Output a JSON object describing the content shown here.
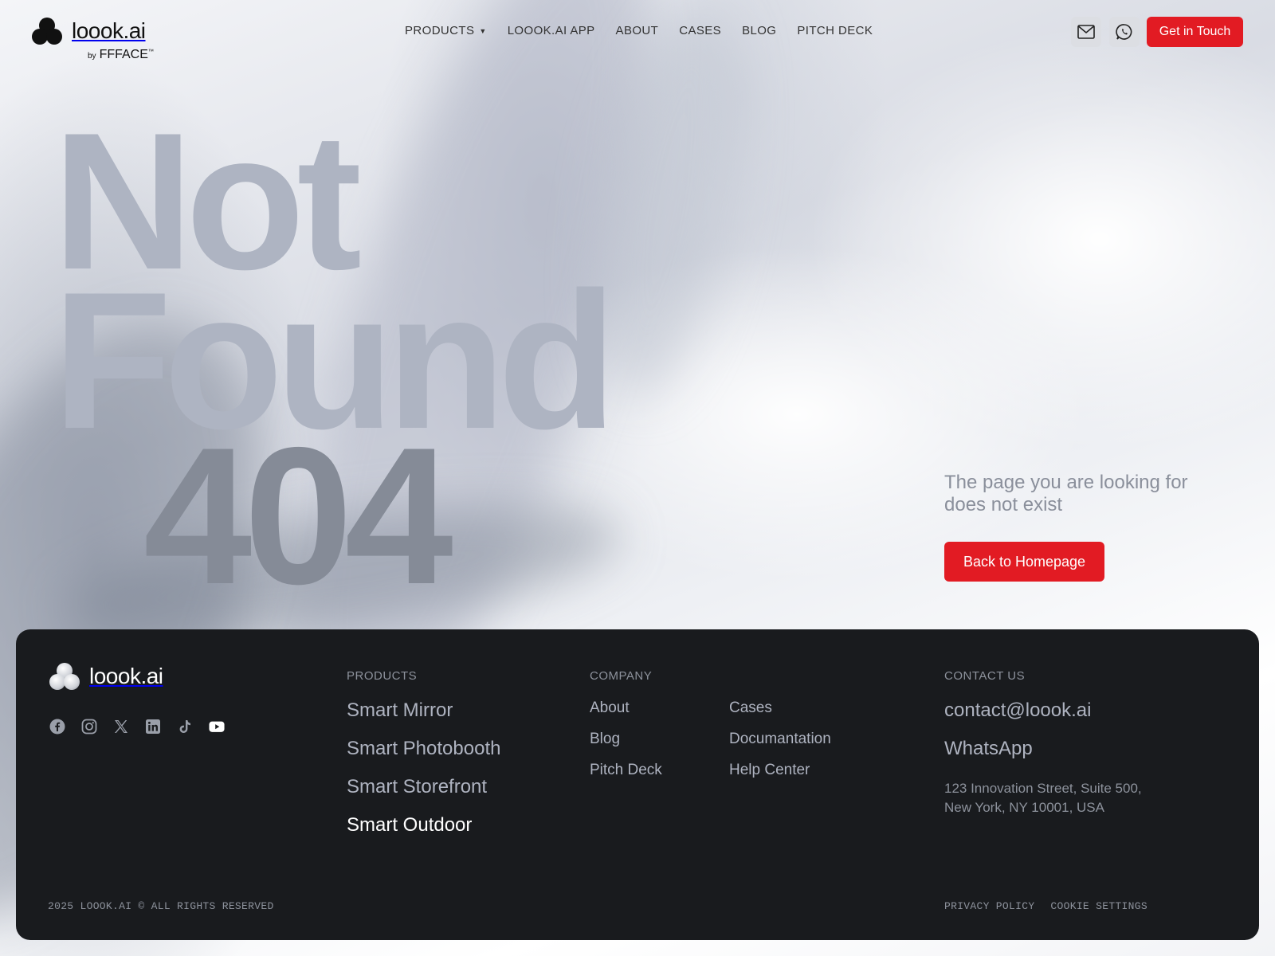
{
  "brand": {
    "name": "loook.ai",
    "by_prefix": "by",
    "by_name": "FFFACE",
    "by_suffix": "™",
    "logo_icon": "three-circles-logo"
  },
  "nav": {
    "items": [
      {
        "label": "PRODUCTS",
        "has_dropdown": true
      },
      {
        "label": "LOOOK.AI APP"
      },
      {
        "label": "ABOUT"
      },
      {
        "label": "CASES"
      },
      {
        "label": "BLOG"
      },
      {
        "label": "PITCH DECK"
      }
    ],
    "mail_icon": "mail-icon",
    "whatsapp_icon": "whatsapp-icon",
    "cta_label": "Get in Touch"
  },
  "hero": {
    "line1": "Not",
    "line2": "Found",
    "code": "404",
    "message": "The page you are looking for does not exist",
    "button_label": "Back to Homepage"
  },
  "footer": {
    "brand_name": "loook.ai",
    "socials": [
      "facebook-icon",
      "instagram-icon",
      "x-icon",
      "linkedin-icon",
      "tiktok-icon",
      "youtube-icon"
    ],
    "products": {
      "heading": "PRODUCTS",
      "items": [
        "Smart Mirror",
        "Smart Photobooth",
        "Smart Storefront",
        "Smart Outdoor"
      ]
    },
    "company": {
      "heading": "COMPANY",
      "col1": [
        "About",
        "Blog",
        "Pitch Deck"
      ],
      "col2": [
        "Cases",
        "Documantation",
        "Help Center"
      ]
    },
    "contact": {
      "heading": "CONTACT US",
      "email": "contact@loook.ai",
      "whatsapp": "WhatsApp",
      "address_line1": "123 Innovation Street, Suite 500,",
      "address_line2": "New York, NY 10001, USA"
    },
    "copyright": "2025 LOOOK.AI © ALL RIGHTS RESERVED",
    "legal": [
      "PRIVACY POLICY",
      "COOKIE SETTINGS"
    ]
  },
  "colors": {
    "accent": "#e21b23",
    "footer_bg": "#191b1e"
  }
}
